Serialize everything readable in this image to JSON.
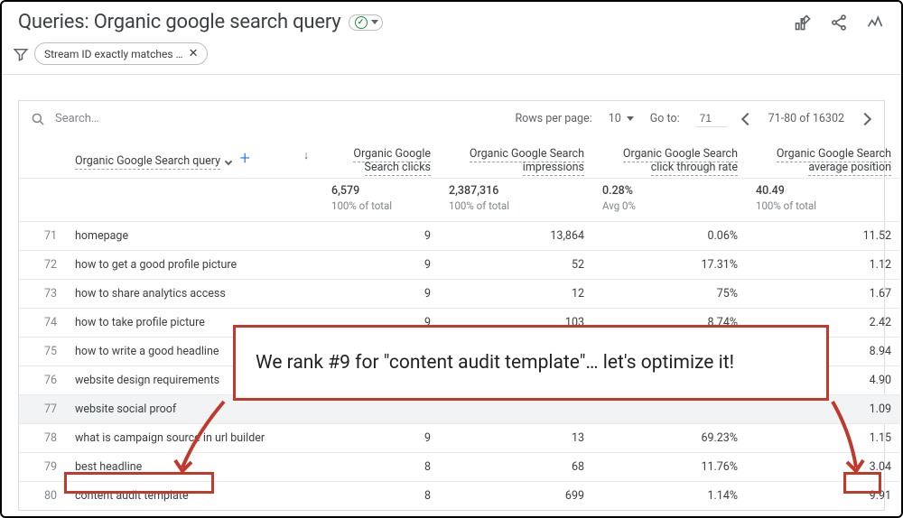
{
  "header": {
    "title_prefix": "Queries:",
    "title_main": "Organic google search query"
  },
  "filter": {
    "chip_label": "Stream ID exactly matches …",
    "chip_close": "✕"
  },
  "card": {
    "search_placeholder": "Search…",
    "rows_per_page_label": "Rows per page:",
    "rows_per_page_value": "10",
    "goto_label": "Go to:",
    "goto_value": "71",
    "range_text": "71-80 of 16302"
  },
  "columns": {
    "query_header": "Organic Google Search query",
    "c1": "Organic Google Search clicks",
    "c2": "Organic Google Search impressions",
    "c3": "Organic Google Search click through rate",
    "c4": "Organic Google Search average position"
  },
  "summary": {
    "c1": "6,579",
    "c1b": "100% of total",
    "c2": "2,387,316",
    "c2b": "100% of total",
    "c3": "0.28%",
    "c3b": "Avg 0%",
    "c4": "40.49",
    "c4b": "100% of total"
  },
  "rows": [
    {
      "n": "71",
      "q": "homepage",
      "c1": "9",
      "c2": "13,864",
      "c3": "0.06%",
      "c4": "11.52"
    },
    {
      "n": "72",
      "q": "how to get a good profile picture",
      "c1": "9",
      "c2": "52",
      "c3": "17.31%",
      "c4": "1.12"
    },
    {
      "n": "73",
      "q": "how to share analytics access",
      "c1": "9",
      "c2": "12",
      "c3": "75%",
      "c4": "1.67"
    },
    {
      "n": "74",
      "q": "how to take profile picture",
      "c1": "9",
      "c2": "103",
      "c3": "8.74%",
      "c4": "2.42"
    },
    {
      "n": "75",
      "q": "how to write a good headline",
      "c1": "",
      "c2": "",
      "c3": "",
      "c4": "8.94"
    },
    {
      "n": "76",
      "q": "website design requirements",
      "c1": "",
      "c2": "",
      "c3": "",
      "c4": "4.90"
    },
    {
      "n": "77",
      "q": "website social proof",
      "c1": "",
      "c2": "",
      "c3": "",
      "c4": "1.09",
      "hl": true
    },
    {
      "n": "78",
      "q": "what is campaign source in url builder",
      "c1": "9",
      "c2": "13",
      "c3": "69.23%",
      "c4": "1.15"
    },
    {
      "n": "79",
      "q": "best headline",
      "c1": "8",
      "c2": "68",
      "c3": "11.76%",
      "c4": "3.04"
    },
    {
      "n": "80",
      "q": "content audit template",
      "c1": "8",
      "c2": "699",
      "c3": "1.14%",
      "c4": "9.91"
    }
  ],
  "annotation": {
    "text": "We rank #9 for \"content audit template\"… let's optimize it!"
  }
}
